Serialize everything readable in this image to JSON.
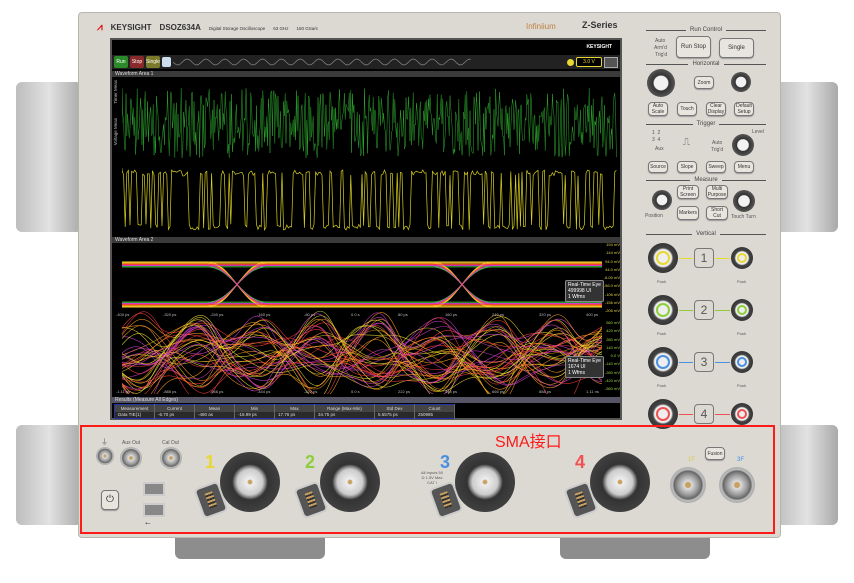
{
  "header": {
    "brand": "KEYSIGHT",
    "model": "DSOZ634A",
    "description": "Digital Storage Oscilloscope",
    "bandwidth": "63 GHz",
    "sample_rate": "160 GSa/s",
    "product_line": "Infiniium",
    "series": "Z-Series"
  },
  "screen": {
    "logo": "KEYSIGHT",
    "toolbar": {
      "run": "Run",
      "stop": "Stop",
      "single": "Single",
      "trigger_level": "3.0 V"
    },
    "area1_label": "Waveform Area 1",
    "area2_label": "Waveform Area 2",
    "side_tabs": [
      "Timer Meas",
      "Voltage Meas"
    ],
    "eye1": {
      "x_ticks": [
        "-400 ps",
        "-320 ps",
        "-240 ps",
        "-160 ps",
        "-80 ps",
        "0.0 s",
        "80 ps",
        "160 ps",
        "240 ps",
        "320 ps",
        "400 ps"
      ],
      "y_ticks": [
        "194 mV",
        "144 mV",
        "94.0 mV",
        "44.0 mV",
        "-6.00 mV",
        "-56.0 mV",
        "-106 mV",
        "-156 mV",
        "-206 mV"
      ],
      "info": [
        "Real-Time Eye",
        "499998 UI",
        "1 Wfms"
      ]
    },
    "eye2": {
      "x_ticks": [
        "-1.11 ns",
        "-888 ps",
        "-666 ps",
        "-444 ps",
        "-222 ps",
        "0.0 s",
        "222 ps",
        "444 ps",
        "666 ps",
        "888 ps",
        "1.11 ns"
      ],
      "y_ticks": [
        "560 mV",
        "420 mV",
        "280 mV",
        "140 mV",
        "0.0 V",
        "-140 mV",
        "-280 mV",
        "-420 mV",
        "-560 mV"
      ],
      "info": [
        "Real-Time Eye",
        "1674 UI",
        "1 Wfms"
      ]
    },
    "results": {
      "title": "Results  (Measure All Edges)",
      "headers": [
        "Measurement",
        "Current",
        "Mean",
        "Min",
        "Max",
        "Range (Max-Min)",
        "Std Dev",
        "Count"
      ],
      "rows": [
        [
          "Data TIE(1)",
          "-6.70 ps",
          "-480 as",
          "-16.99 ps",
          "17.76 ps",
          "34.75 ps",
          "5.5575 ps",
          "250985"
        ]
      ]
    }
  },
  "panel": {
    "run_control": {
      "title": "Run Control",
      "status": [
        "Auto",
        "Arm'd",
        "Trig'd"
      ],
      "run_stop": "Run Stop",
      "single": "Single"
    },
    "horizontal": {
      "title": "Horizontal",
      "zoom": "Zoom",
      "auto_scale": "Auto Scale",
      "touch": "Touch",
      "clear_display": "Clear Display",
      "default_setup": "Default Setup"
    },
    "trigger": {
      "title": "Trigger",
      "level": "Level",
      "status": [
        "Auto",
        "Trig'd"
      ],
      "aux": "Aux",
      "source": "Source",
      "slope": "Slope",
      "sweep": "Sweep",
      "menu": "Menu"
    },
    "measure": {
      "title": "Measure",
      "print_screen": "Print Screen",
      "multi_purpose": "Multi Purpose",
      "markers": "Markers",
      "short_cut": "Short Cut",
      "position": "Position",
      "touch_turn": "Touch Turn"
    },
    "vertical": {
      "title": "Vertical",
      "channels": [
        "1",
        "2",
        "3",
        "4"
      ],
      "push": "Push"
    },
    "front": {
      "aux_out": "Aux Out",
      "cal_out": "Cal Out",
      "fusion": "Fusion",
      "ch1f": "1F",
      "ch3f": "3F",
      "warning": "All Inputs 50 Ω 1.5V Max CAT I"
    }
  },
  "annotation": {
    "label": "SMA接口",
    "color": "#ff1a1a"
  },
  "colors": {
    "ch1": "#e8d830",
    "ch2": "#8ccf3a",
    "ch3": "#4a90e0",
    "ch4": "#f05050"
  }
}
